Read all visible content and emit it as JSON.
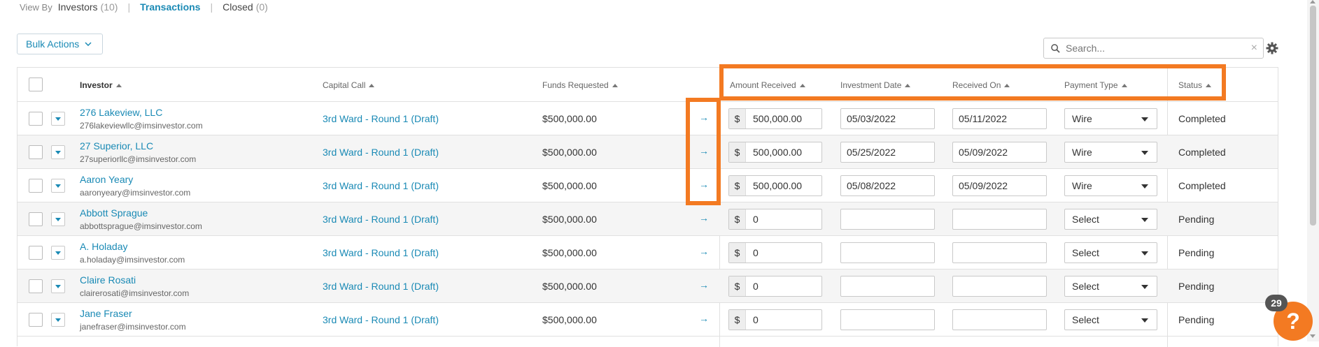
{
  "view_by": {
    "label": "View By",
    "options": [
      {
        "label": "Investors",
        "count": "(10)"
      },
      {
        "label": "Transactions"
      },
      {
        "label": "Closed",
        "count": "(0)"
      }
    ],
    "separator": "|"
  },
  "bulk_actions_label": "Bulk Actions",
  "search": {
    "placeholder": "Search...",
    "clear": "×"
  },
  "columns": {
    "investor": "Investor",
    "capital_call": "Capital Call",
    "funds_requested": "Funds Requested",
    "amount_received": "Amount Received",
    "investment_date": "Investment Date",
    "received_on": "Received On",
    "payment_type": "Payment Type",
    "status": "Status"
  },
  "currency_symbol": "$",
  "row_arrow": "→",
  "rows": [
    {
      "name": "276 Lakeview, LLC",
      "email": "276lakeviewllc@imsinvestor.com",
      "capital_call": "3rd Ward - Round 1 (Draft)",
      "funds": "$500,000.00",
      "amount": "500,000.00",
      "inv_date": "05/03/2022",
      "received_on": "05/11/2022",
      "payment_type": "Wire",
      "status": "Completed"
    },
    {
      "name": "27 Superior, LLC",
      "email": "27superiorllc@imsinvestor.com",
      "capital_call": "3rd Ward - Round 1 (Draft)",
      "funds": "$500,000.00",
      "amount": "500,000.00",
      "inv_date": "05/25/2022",
      "received_on": "05/09/2022",
      "payment_type": "Wire",
      "status": "Completed"
    },
    {
      "name": "Aaron Yeary",
      "email": "aaronyeary@imsinvestor.com",
      "capital_call": "3rd Ward - Round 1 (Draft)",
      "funds": "$500,000.00",
      "amount": "500,000.00",
      "inv_date": "05/08/2022",
      "received_on": "05/09/2022",
      "payment_type": "Wire",
      "status": "Completed"
    },
    {
      "name": "Abbott Sprague",
      "email": "abbottsprague@imsinvestor.com",
      "capital_call": "3rd Ward - Round 1 (Draft)",
      "funds": "$500,000.00",
      "amount": "0",
      "inv_date": "",
      "received_on": "",
      "payment_type": "Select",
      "status": "Pending"
    },
    {
      "name": "A. Holaday",
      "email": "a.holaday@imsinvestor.com",
      "capital_call": "3rd Ward - Round 1 (Draft)",
      "funds": "$500,000.00",
      "amount": "0",
      "inv_date": "",
      "received_on": "",
      "payment_type": "Select",
      "status": "Pending"
    },
    {
      "name": "Claire Rosati",
      "email": "clairerosati@imsinvestor.com",
      "capital_call": "3rd Ward - Round 1 (Draft)",
      "funds": "$500,000.00",
      "amount": "0",
      "inv_date": "",
      "received_on": "",
      "payment_type": "Select",
      "status": "Pending"
    },
    {
      "name": "Jane Fraser",
      "email": "janefraser@imsinvestor.com",
      "capital_call": "3rd Ward - Round 1 (Draft)",
      "funds": "$500,000.00",
      "amount": "0",
      "inv_date": "",
      "received_on": "",
      "payment_type": "Select",
      "status": "Pending"
    }
  ],
  "help": {
    "badge": "29",
    "icon": "?"
  },
  "colors": {
    "accent": "#1a8ab5",
    "highlight": "#f37a22"
  }
}
